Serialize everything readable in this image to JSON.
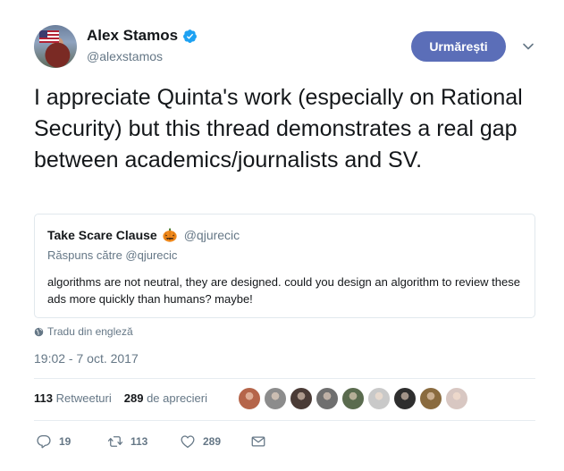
{
  "author": {
    "display_name": "Alex Stamos",
    "handle": "@alexstamos",
    "verified": true
  },
  "header": {
    "follow_label": "Urmărești",
    "accent_color": "#5b6eb8"
  },
  "tweet": {
    "text": "I appreciate Quinta's work (especially on Rational Security) but this thread demonstrates a real gap between academics/journalists and SV."
  },
  "quote": {
    "display_name": "Take Scare Clause",
    "emoji": "pumpkin",
    "handle": "@qjurecic",
    "reply_prefix": "Răspuns către @qjurecic",
    "text": "algorithms are not neutral, they are designed. could you design an algorithm to review these ads more quickly than humans? maybe!"
  },
  "translate_label": "Tradu din engleză",
  "timestamp": "19:02 - 7 oct. 2017",
  "stats": {
    "retweets_count": "113",
    "retweets_label": "Retweeturi",
    "likes_count": "289",
    "likes_label": "de aprecieri"
  },
  "likers": [
    {
      "name": "liker-1",
      "color": "#b5654a"
    },
    {
      "name": "liker-2",
      "color": "#8c8c8c"
    },
    {
      "name": "liker-3",
      "color": "#4a3b36"
    },
    {
      "name": "liker-4",
      "color": "#6f6f6f"
    },
    {
      "name": "liker-5",
      "color": "#5a6b4e"
    },
    {
      "name": "liker-6",
      "color": "#c9c9c9"
    },
    {
      "name": "liker-7",
      "color": "#2e2e2e"
    },
    {
      "name": "liker-8",
      "color": "#8a6b3f"
    },
    {
      "name": "liker-9",
      "color": "#d8c7c2"
    }
  ],
  "actions": {
    "reply_count": "19",
    "retweet_count": "113",
    "like_count": "289"
  }
}
